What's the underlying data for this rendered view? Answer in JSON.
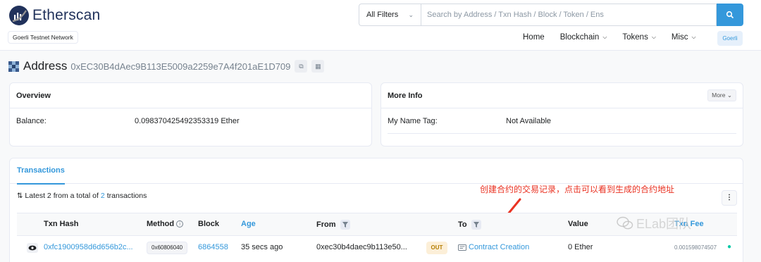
{
  "brand": {
    "name": "Etherscan",
    "network": "Goerli Testnet Network"
  },
  "search": {
    "filter_value": "All Filters",
    "placeholder": "Search by Address / Txn Hash / Block / Token / Ens"
  },
  "nav": {
    "home": "Home",
    "blockchain": "Blockchain",
    "tokens": "Tokens",
    "misc": "Misc",
    "network_button": "Goerli"
  },
  "address": {
    "title": "Address",
    "hash": "0xEC30B4dAec9B113E5009a2259e7A4f201aE1D709"
  },
  "overview": {
    "heading": "Overview",
    "balance_label": "Balance:",
    "balance_value": "0.098370425492353319 Ether"
  },
  "more_info": {
    "heading": "More Info",
    "more_button": "More",
    "name_tag_label": "My Name Tag:",
    "name_tag_value": "Not Available"
  },
  "transactions": {
    "tab_label": "Transactions",
    "summary_prefix": "Latest",
    "summary_count": "2",
    "summary_middle": "from a total of",
    "summary_total": "2",
    "summary_suffix": "transactions",
    "annotation": "创建合约的交易记录，点击可以看到生成的合约地址",
    "columns": {
      "hash": "Txn Hash",
      "method": "Method",
      "block": "Block",
      "age": "Age",
      "from": "From",
      "to": "To",
      "value": "Value",
      "fee": "Txn Fee"
    },
    "rows": [
      {
        "hash": "0xfc1900958d6d656b2c...",
        "method": "0x60806040",
        "block": "6864558",
        "age": "35 secs ago",
        "from": "0xec30b4daec9b113e50...",
        "direction": "OUT",
        "to": "Contract Creation",
        "value": "0 Ether",
        "fee": "0.001598074507"
      }
    ]
  },
  "watermark": "ELab团队",
  "colors": {
    "accent": "#3498db",
    "brand_dark": "#21325b",
    "annotation": "#ea3323",
    "out_badge_bg": "#fcefd8"
  }
}
